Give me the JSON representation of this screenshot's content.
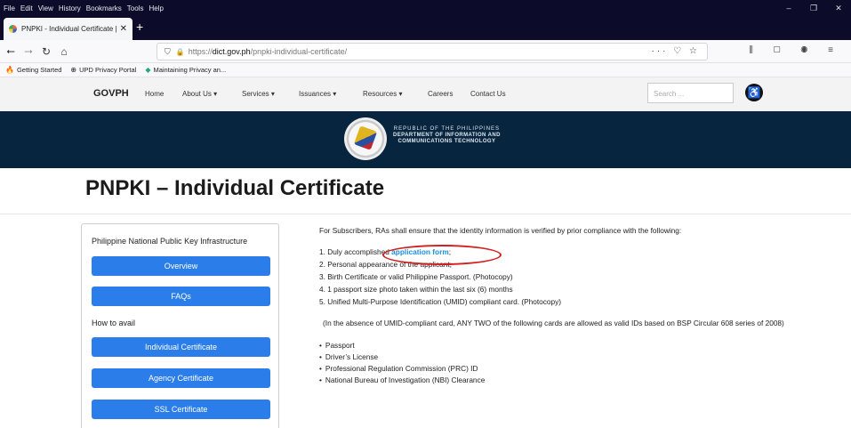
{
  "browser": {
    "menu": [
      "File",
      "Edit",
      "View",
      "History",
      "Bookmarks",
      "Tools",
      "Help"
    ],
    "window_controls": [
      "–",
      "❐",
      "✕"
    ],
    "tab_title": "PNPKI - Individual Certificate |",
    "tab_close": "✕",
    "new_tab": "+",
    "url_prefix": "https://",
    "url_domain": "dict.gov.ph",
    "url_path": "/pnpki-individual-certificate/",
    "url_actions": "··· ♡ ☆",
    "right_tools": "⫼ ▢ ◉ ≡",
    "bookmarks": [
      {
        "icon": "🔥",
        "label": "Getting Started"
      },
      {
        "icon": "⊕",
        "label": "UPD Privacy Portal"
      },
      {
        "icon": "◆",
        "label": "Maintaining Privacy an..."
      }
    ]
  },
  "site": {
    "logo_text": "GOVPH",
    "nav": [
      {
        "label": "Home"
      },
      {
        "label": "About Us ▾"
      },
      {
        "label": "Services ▾"
      },
      {
        "label": "Issuances ▾"
      },
      {
        "label": "Resources ▾"
      },
      {
        "label": "Careers"
      },
      {
        "label": "Contact Us"
      }
    ],
    "search_placeholder": "Search ...",
    "banner": {
      "line1": "REPUBLIC OF THE PHILIPPINES",
      "line2": "DEPARTMENT OF INFORMATION AND",
      "line3": "COMMUNICATIONS TECHNOLOGY"
    },
    "page_title": "PNPKI – Individual Certificate"
  },
  "sidebar": {
    "title": "Philippine National Public Key Infrastructure",
    "buttons": [
      "Overview",
      "FAQs",
      "Individual Certificate",
      "Agency Certificate",
      "SSL Certificate"
    ],
    "how_label": "How to avail"
  },
  "content": {
    "intro": "For Subscribers, RAs shall ensure that the identity information is verified by prior compliance with the following:",
    "item1_prefix": "1. Duly accomplished ",
    "item1_link": "application form",
    "item1_suffix": ";",
    "items": [
      "2. Personal appearance of the applicant;",
      "3. Birth Certificate or valid Philippine Passport. (Photocopy)",
      "4. 1 passport size photo taken within the last six (6) months",
      "5. Unified Multi-Purpose Identification (UMID) compliant card. (Photocopy)"
    ],
    "note": "(In the absence of UMID-compliant card, ANY TWO of the following cards are allowed as valid IDs based on BSP Circular 608 series of 2008)",
    "ids": [
      "Passport",
      "Driver’s License",
      "Professional Regulation Commission (PRC) ID",
      "National Bureau of Investigation (NBI) Clearance"
    ]
  }
}
